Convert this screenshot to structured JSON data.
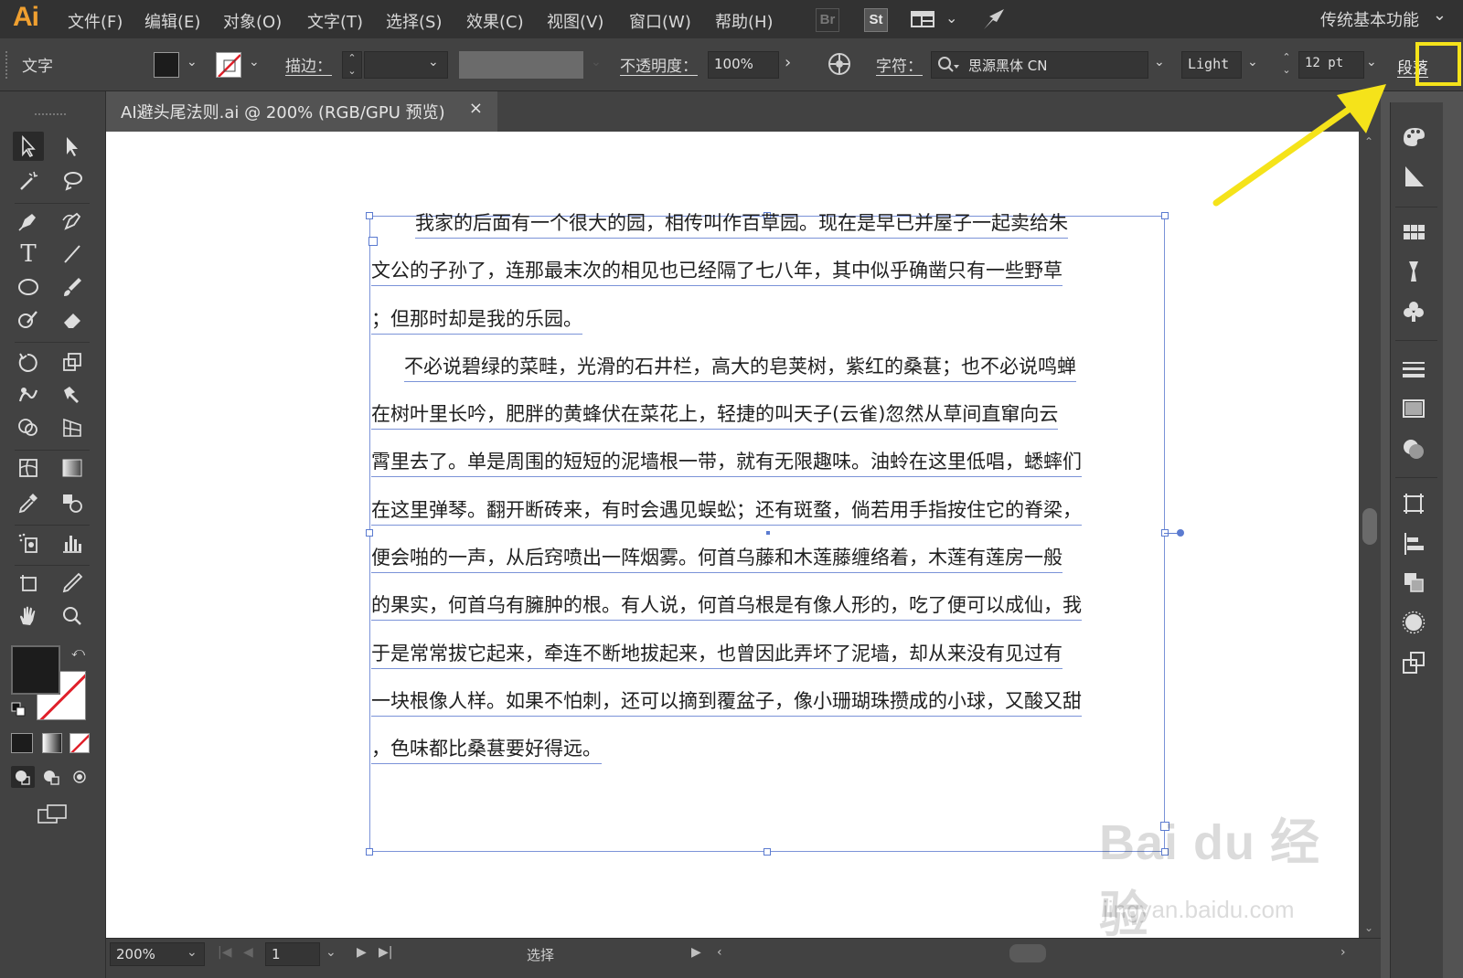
{
  "app": {
    "logo": "Ai",
    "menus": [
      "文件(F)",
      "编辑(E)",
      "对象(O)",
      "文字(T)",
      "选择(S)",
      "效果(C)",
      "视图(V)",
      "窗口(W)",
      "帮助(H)"
    ],
    "bridge_label": "Br",
    "stock_label": "St",
    "workspace": "传统基本功能"
  },
  "control": {
    "type_label": "文字",
    "stroke_label": "描边：",
    "opacity_label": "不透明度：",
    "opacity_value": "100%",
    "char_label": "字符：",
    "font_family": "思源黑体 CN",
    "font_style": "Light",
    "font_size": "12 pt",
    "paragraph_label": "段落"
  },
  "document": {
    "tab_title": "AI避头尾法则.ai @ 200% (RGB/GPU 预览)",
    "close_glyph": "×"
  },
  "text_lines": [
    "我家的后面有一个很大的园，相传叫作百草园。现在是早已并屋子一起卖给朱",
    "文公的子孙了，连那最末次的相见也已经隔了七八年，其中似乎确凿只有一些野草",
    "；但那时却是我的乐园。",
    "不必说碧绿的菜畦，光滑的石井栏，高大的皂荚树，紫红的桑葚；也不必说鸣蝉",
    "在树叶里长吟，肥胖的黄蜂伏在菜花上，轻捷的叫天子(云雀)忽然从草间直窜向云",
    "霄里去了。单是周围的短短的泥墙根一带，就有无限趣味。油蛉在这里低唱，蟋蟀们",
    "在这里弹琴。翻开断砖来，有时会遇见蜈蚣；还有斑蝥，倘若用手指按住它的脊梁，",
    "便会啪的一声，从后窍喷出一阵烟雾。何首乌藤和木莲藤缠络着，木莲有莲房一般",
    "的果实，何首乌有臃肿的根。有人说，何首乌根是有像人形的，吃了便可以成仙，我",
    "于是常常拔它起来，牵连不断地拔起来，也曾因此弄坏了泥墙，却从来没有见过有",
    "一块根像人样。如果不怕刺，还可以摘到覆盆子，像小珊瑚珠攒成的小球，又酸又甜",
    "，色味都比桑葚要好得远。"
  ],
  "status": {
    "zoom": "200%",
    "page": "1",
    "tool_status": "选择"
  },
  "watermark": {
    "logo": "Bai du 经验",
    "url": "jingyan.baidu.com"
  },
  "colors": {
    "highlight": "#f5e31a",
    "selection": "#7b93d8",
    "logo": "#f0a030"
  }
}
